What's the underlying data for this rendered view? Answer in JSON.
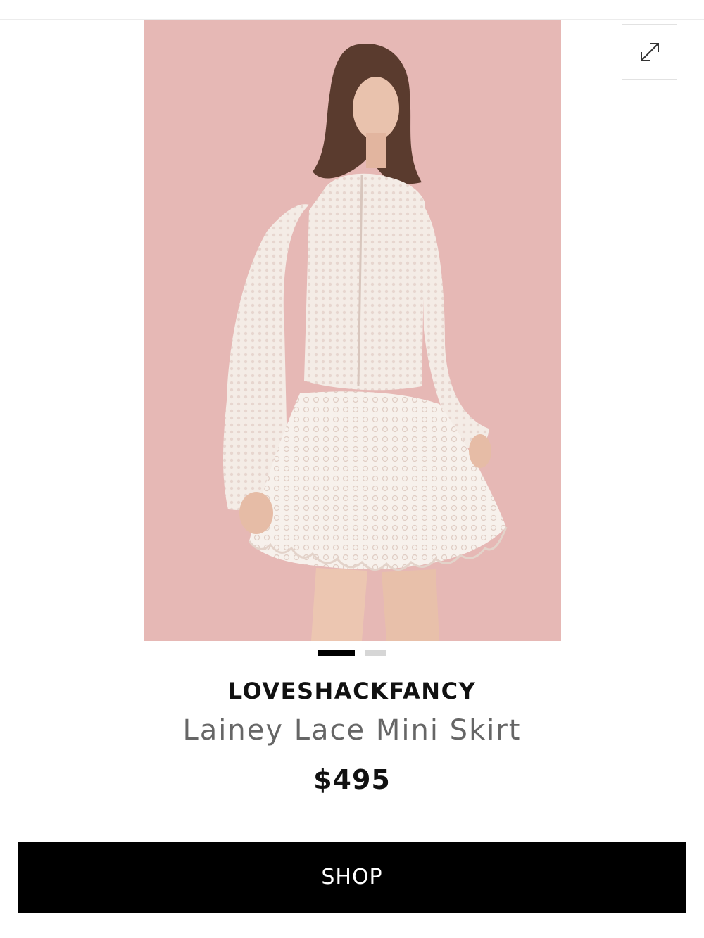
{
  "product": {
    "brand": "LOVESHACKFANCY",
    "name": "Lainey Lace Mini Skirt",
    "price": "$495",
    "image_alt": "Model wearing white lace cropped cardigan and white lace mini skirt against pink background"
  },
  "gallery": {
    "slide_count": 2,
    "active_index": 0
  },
  "actions": {
    "shop_label": "SHOP",
    "expand_icon": "expand-icon"
  },
  "colors": {
    "background": "#ffffff",
    "image_backdrop": "#e6b8b5",
    "button": "#000000",
    "button_text": "#ffffff",
    "dot_active": "#000000",
    "dot_inactive": "#d6d6d6"
  }
}
